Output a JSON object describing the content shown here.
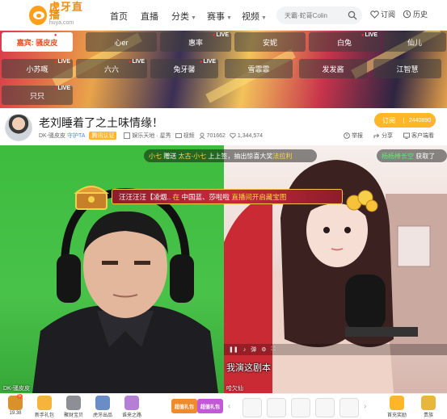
{
  "nav": {
    "logo_cn": "虎牙直播",
    "logo_en": "huya.com",
    "items": [
      "首页",
      "直播",
      "分类",
      "赛事",
      "视频"
    ],
    "search_placeholder": "天霸·蛇哥Colin",
    "subscribe_label": "订阅",
    "history_label": "历史"
  },
  "categories": [
    {
      "label": "嘉宾: 骚皮皮",
      "live": "LIVE",
      "active": true
    },
    {
      "label": "心er",
      "live": ""
    },
    {
      "label": "惠率",
      "live": "LIVE"
    },
    {
      "label": "安妮",
      "live": ""
    },
    {
      "label": "白兔",
      "live": "LIVE"
    },
    {
      "label": "仙儿",
      "live": ""
    },
    {
      "label": "小苏嘅",
      "live": "LIVE"
    },
    {
      "label": "六六",
      "live": "LIVE"
    },
    {
      "label": "兔牙馨",
      "live": "LIVE"
    },
    {
      "label": "雪霏霏",
      "live": ""
    },
    {
      "label": "发发酱",
      "live": ""
    },
    {
      "label": "江智慧",
      "live": ""
    },
    {
      "label": "只只",
      "live": "LIVE"
    }
  ],
  "room": {
    "title": "老刘睡着了之土味情缘！",
    "host": "DK-骚皮皮",
    "guard": "守护TA",
    "cert": "腾讯认证",
    "category": "娱乐天地",
    "tag": "星秀",
    "video": "视频",
    "count1": "701662",
    "count2": "1,344,574",
    "subscribe": "订阅",
    "subscribe_count": "2440890",
    "report": "举报",
    "share": "分享",
    "client": "客户端看"
  },
  "video": {
    "ticker_main": [
      "小七",
      "赠送",
      "太古",
      "小七",
      "上上签",
      "抽出惊喜大奖",
      "法拉利"
    ],
    "ticker_right": [
      "杨杨棒长空",
      "获取了"
    ],
    "treasure_user": "汪汪汪汪【凌烟..",
    "treasure_mid": "在",
    "treasure_from": "中国蓝、莎啦啦",
    "treasure_tail": "直播间开启藏宝图",
    "subtitle": "我演这剧本",
    "name_left": "DK-骚皮皮",
    "name_right": "哈欠仙"
  },
  "gifts": [
    {
      "label": "19.38",
      "count": "5"
    },
    {
      "label": "新手礼包"
    },
    {
      "label": "聚财宝贝"
    },
    {
      "label": "虎牙出品"
    },
    {
      "label": "谁来之路"
    }
  ],
  "gift_pills": [
    "超值礼包",
    "超值礼包"
  ],
  "gift_right": [
    "首充奖励",
    "贵族"
  ],
  "colors": {
    "brand": "#ff8a00",
    "accent": "#ffb627",
    "live": "#ff2a2a"
  }
}
